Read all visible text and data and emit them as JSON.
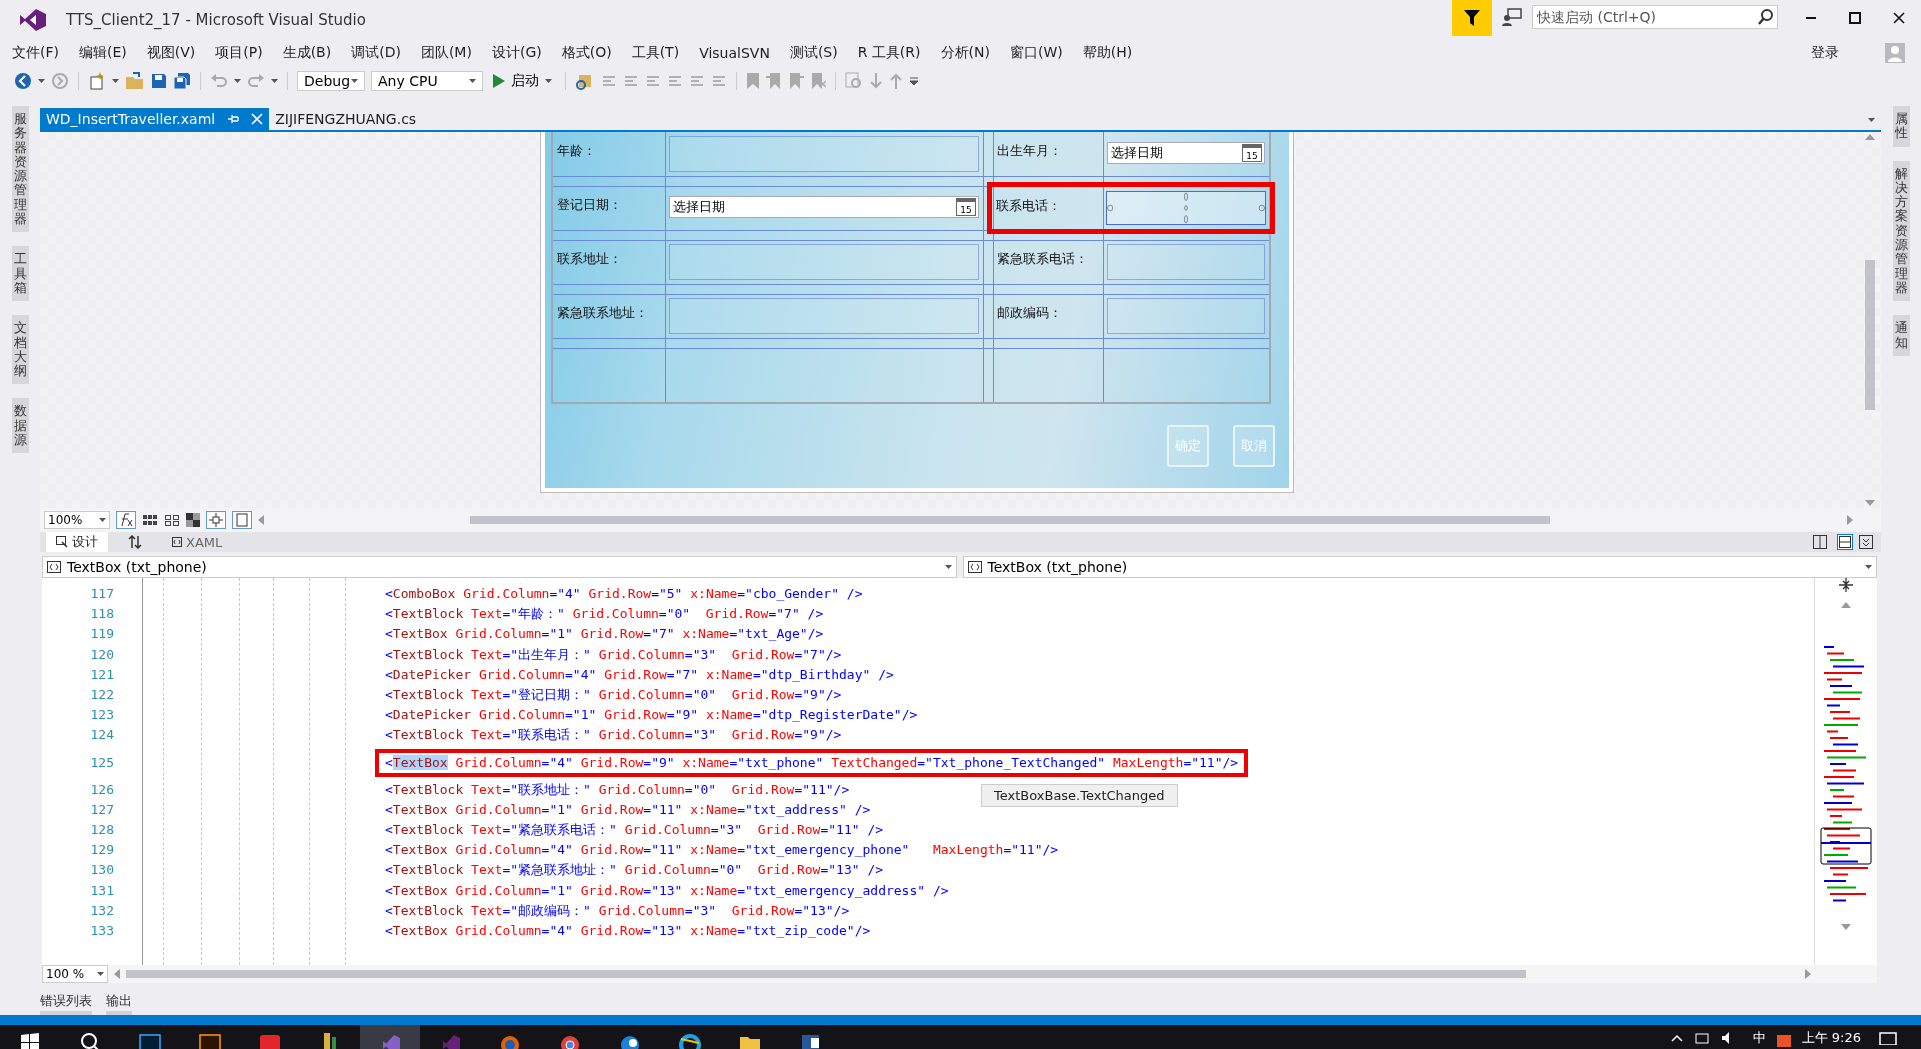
{
  "window": {
    "title": "TTS_Client2_17 - Microsoft Visual Studio",
    "quick_launch": {
      "placeholder": "快速启动 (Ctrl+Q)"
    },
    "sign_in": "登录"
  },
  "menu": [
    "文件(F)",
    "编辑(E)",
    "视图(V)",
    "项目(P)",
    "生成(B)",
    "调试(D)",
    "团队(M)",
    "设计(G)",
    "格式(O)",
    "工具(T)",
    "VisualSVN",
    "测试(S)",
    "R 工具(R)",
    "分析(N)",
    "窗口(W)",
    "帮助(H)"
  ],
  "toolbar": {
    "configuration": "Debug",
    "platform": "Any CPU",
    "start": "启动"
  },
  "left_tool_tabs": [
    "服务器资源管理器",
    "工具箱",
    "文档大纲",
    "数据源"
  ],
  "right_tool_tabs": [
    "属性",
    "解决方案资源管理器",
    "通知"
  ],
  "document_tabs": [
    {
      "label": "WD_InsertTraveller.xaml",
      "selected": true
    },
    {
      "label": "ZIJIFENGZHUANG.cs",
      "selected": false
    }
  ],
  "designer": {
    "rows": [
      {
        "cells": [
          {
            "kind": "label",
            "text": "年龄："
          },
          {
            "kind": "text",
            "selected": false
          },
          {
            "kind": "label",
            "text": "出生年月："
          },
          {
            "kind": "date",
            "placeholder": "选择日期",
            "day": "15"
          }
        ]
      },
      {
        "cells": [
          {
            "kind": "label",
            "text": "登记日期："
          },
          {
            "kind": "date",
            "placeholder": "选择日期",
            "day": "15"
          },
          {
            "kind": "label",
            "text": "联系电话："
          },
          {
            "kind": "text",
            "selected": true
          }
        ]
      },
      {
        "cells": [
          {
            "kind": "label",
            "text": "联系地址："
          },
          {
            "kind": "text",
            "selected": false
          },
          {
            "kind": "label",
            "text": "紧急联系电话："
          },
          {
            "kind": "text",
            "selected": false
          }
        ]
      },
      {
        "cells": [
          {
            "kind": "label",
            "text": "紧急联系地址："
          },
          {
            "kind": "text",
            "selected": false
          },
          {
            "kind": "label",
            "text": "邮政编码："
          },
          {
            "kind": "text",
            "selected": false
          }
        ]
      }
    ],
    "buttons": [
      "确定",
      "取消"
    ],
    "zoom": "100%"
  },
  "view_tabs": [
    {
      "label": "设计",
      "selected": true
    },
    {
      "label": "XAML",
      "selected": false
    }
  ],
  "element_selectors": [
    "TextBox (txt_phone)",
    "TextBox (txt_phone)"
  ],
  "code": {
    "lines": [
      {
        "number": "117",
        "text": "<ComboBox Grid.Column=\"4\" Grid.Row=\"5\" x:Name=\"cbo_Gender\" />",
        "boxed": false
      },
      {
        "number": "118",
        "text": "<TextBlock Text=\"年龄：\" Grid.Column=\"0\"  Grid.Row=\"7\" />",
        "boxed": false
      },
      {
        "number": "119",
        "text": "<TextBox Grid.Column=\"1\" Grid.Row=\"7\" x:Name=\"txt_Age\"/>",
        "boxed": false
      },
      {
        "number": "120",
        "text": "<TextBlock Text=\"出生年月：\" Grid.Column=\"3\"  Grid.Row=\"7\"/>",
        "boxed": false
      },
      {
        "number": "121",
        "text": "<DatePicker Grid.Column=\"4\" Grid.Row=\"7\" x:Name=\"dtp_Birthday\" />",
        "boxed": false
      },
      {
        "number": "122",
        "text": "<TextBlock Text=\"登记日期：\" Grid.Column=\"0\"  Grid.Row=\"9\"/>",
        "boxed": false
      },
      {
        "number": "123",
        "text": "<DatePicker Grid.Column=\"1\" Grid.Row=\"9\" x:Name=\"dtp_RegisterDate\"/>",
        "boxed": false
      },
      {
        "number": "124",
        "text": "<TextBlock Text=\"联系电话：\" Grid.Column=\"3\"  Grid.Row=\"9\"/>",
        "boxed": false
      },
      {
        "number": "125",
        "lead": "<",
        "selection": "TextBox",
        "text": " Grid.Column=\"4\" Grid.Row=\"9\" x:Name=\"txt_phone\" TextChanged=\"Txt_phone_TextChanged\" MaxLength=\"11\"/>",
        "boxed": true
      },
      {
        "number": "126",
        "text": "<TextBlock Text=\"联系地址：\" Grid.Column=\"0\"  Grid.Row=\"11\"/>",
        "boxed": false
      },
      {
        "number": "127",
        "text": "<TextBox Grid.Column=\"1\" Grid.Row=\"11\" x:Name=\"txt_address\" />",
        "boxed": false
      },
      {
        "number": "128",
        "text": "<TextBlock Text=\"紧急联系电话：\" Grid.Column=\"3\"  Grid.Row=\"11\" />",
        "boxed": false
      },
      {
        "number": "129",
        "text": "<TextBox Grid.Column=\"4\" Grid.Row=\"11\" x:Name=\"txt_emergency_phone\"   MaxLength=\"11\"/>",
        "boxed": false
      },
      {
        "number": "130",
        "text": "<TextBlock Text=\"紧急联系地址：\" Grid.Column=\"0\"  Grid.Row=\"13\" />",
        "boxed": false
      },
      {
        "number": "131",
        "text": "<TextBox Grid.Column=\"1\" Grid.Row=\"13\" x:Name=\"txt_emergency_address\" />",
        "boxed": false
      },
      {
        "number": "132",
        "text": "<TextBlock Text=\"邮政编码：\" Grid.Column=\"3\"  Grid.Row=\"13\"/>",
        "boxed": false
      },
      {
        "number": "133",
        "text": "<TextBox Grid.Column=\"4\" Grid.Row=\"13\" x:Name=\"txt_zip_code\"/>",
        "boxed": false
      }
    ],
    "tooltip": "TextBoxBase.TextChanged",
    "zoom": "100 %"
  },
  "bottom_tabs": [
    "错误列表",
    "输出"
  ],
  "taskbar": {
    "input_method": "中",
    "clock": "上午 9:26"
  }
}
